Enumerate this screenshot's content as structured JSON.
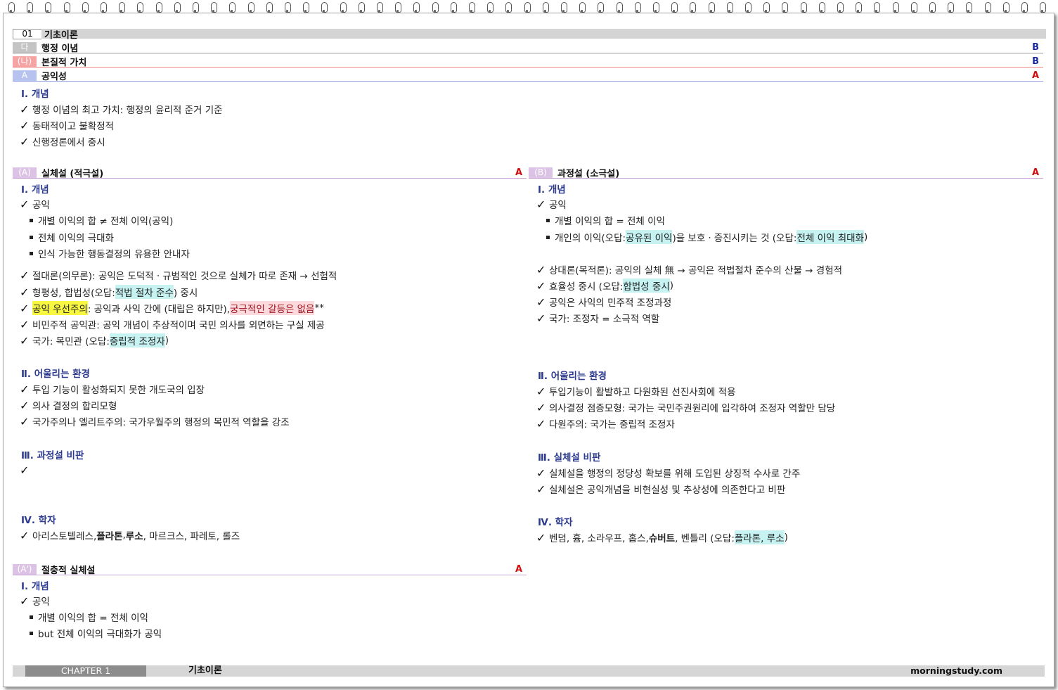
{
  "chapter_header": {
    "number": "01",
    "title": "기초이론"
  },
  "bar_da": {
    "tag": "다",
    "title": "행정 이념",
    "grade": "B"
  },
  "bar_na": {
    "tag": "(나)",
    "title": "본질적 가치",
    "grade": "B"
  },
  "bar_a": {
    "tag": "A",
    "title": "공익성",
    "grade": "A"
  },
  "intro": {
    "heading": "Ⅰ. 개념",
    "items": [
      "행정 이념의 최고 가치: 행정의 윤리적 준거 기준",
      "동태적이고 불확정적",
      "신행정론에서 중시"
    ]
  },
  "left": {
    "bar": {
      "tag": "(A)",
      "title": "실체설 (적극설)",
      "grade": "A"
    },
    "s1": {
      "heading": "Ⅰ. 개념",
      "check1": "공익",
      "bullets": [
        "개별 이익의 합 ≠ 전체 이익(공익)",
        "전체 이익의 극대화",
        "인식 가능한 행동결정의 유용한 안내자"
      ],
      "item_absolutism": "절대론(의무론): 공익은 도덕적ㆍ규범적인 것으로 실체가 따로 존재 → 선험적",
      "item_equity_pre": "형평성, 합법성(오답: ",
      "item_equity_hl": "적법 절차 준수",
      "item_equity_post": ") 중시",
      "item_priority_hl": "공익 우선주의",
      "item_priority_mid": ": 공익과 사익 간에 (대립은 하지만), ",
      "item_priority_hl2": "궁극적인 갈등은 없음",
      "item_priority_post": "**",
      "item_undemocratic": "비민주적 공익관: 공익 개념이 추상적이며 국민 의사를 외면하는 구실 제공",
      "item_state_pre": "국가: 목민관 (오답: ",
      "item_state_hl": "중립적 조정자",
      "item_state_post": ")"
    },
    "s2": {
      "heading": "Ⅱ. 어울리는 환경",
      "items": [
        "투입 기능이 활성화되지 못한 개도국의 입장",
        "의사 결정의 합리모형",
        "국가주의나 엘리트주의: 국가우월주의 행정의 목민적 역할을 강조"
      ]
    },
    "s3": {
      "heading": "Ⅲ. 과정설 비판"
    },
    "s4": {
      "heading": "Ⅳ. 학자",
      "s_aristotle": "아리스토텔레스, ",
      "s_plato": "플라톤",
      "s_sep1": ", ",
      "s_rousseau": "루소",
      "s_rest": ", 마르크스, 파레토, 롤즈"
    }
  },
  "right": {
    "bar": {
      "tag": "(B)",
      "title": "과정설 (소극설)",
      "grade": "A"
    },
    "s1": {
      "heading": "Ⅰ. 개념",
      "check1": "공익",
      "bullet1": "개별 이익의 합 = 전체 이익",
      "bullet2_pre": "개인의 이익(오답: ",
      "bullet2_hl1": "공유된 이익",
      "bullet2_mid": ")을 보호ㆍ증진시키는 것 (오답: ",
      "bullet2_hl2": "전체 이익 최대화",
      "bullet2_post": ")",
      "item_relativism": "상대론(목적론): 공익의 실체 無 → 공익은 적법절차 준수의 산물 → 경험적",
      "item_eff_pre": "효율성 중시 (오답: ",
      "item_eff_hl": "합법성 중시",
      "item_eff_post": ")",
      "item_coord": "공익은 사익의 민주적 조정과정",
      "item_state": "국가: 조정자 = 소극적 역할"
    },
    "s2": {
      "heading": "Ⅱ. 어울리는 환경",
      "items": [
        "투입기능이 활발하고 다원화된 선진사회에 적용",
        "의사결정 점증모형: 국가는 국민주권원리에 입각하여 조정자 역할만 담당",
        "다원주의: 국가는 중립적 조정자"
      ]
    },
    "s3": {
      "heading": "Ⅲ. 실체설 비판",
      "items": [
        "실체설을 행정의 정당성 확보를 위해 도입된 상징적 수사로 간주",
        "실체설은 공익개념을 비현실성 및 추상성에 의존한다고 비판"
      ]
    },
    "s4": {
      "heading": "Ⅳ. 학자",
      "s_pre": "벤덤, 흄, 소라우프, 홉스, ",
      "s_schubert": "슈버트",
      "s_mid": ", 벤틀리 (오답: ",
      "s_hl": "플라톤, 루소",
      "s_post": ")"
    }
  },
  "eclectic": {
    "bar": {
      "tag": "(A')",
      "title": "절충적 실체설",
      "grade": "A"
    },
    "heading": "Ⅰ. 개념",
    "check1": "공익",
    "bullets": [
      "개별 이익의 합 = 전체 이익",
      "but 전체 이익의 극대화가 공익"
    ]
  },
  "footer": {
    "chapter": "CHAPTER 1",
    "title": "기초이론",
    "site": "morningstudy.com"
  }
}
